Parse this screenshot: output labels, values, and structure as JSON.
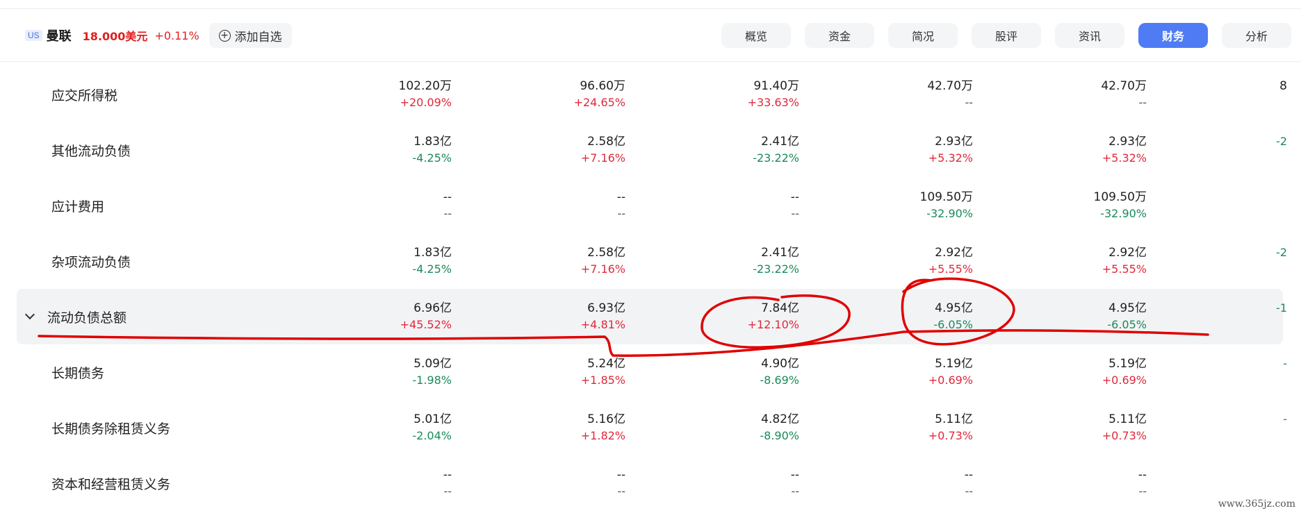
{
  "header": {
    "market_badge": "US",
    "name": "曼联",
    "price": "18.000美元",
    "change_pct": "+0.11%",
    "watch_label": "添加自选",
    "watch_icon": "plus-circle-icon"
  },
  "tabs": [
    {
      "label": "概览",
      "active": false
    },
    {
      "label": "资金",
      "active": false
    },
    {
      "label": "简况",
      "active": false
    },
    {
      "label": "股评",
      "active": false
    },
    {
      "label": "资讯",
      "active": false
    },
    {
      "label": "财务",
      "active": true
    },
    {
      "label": "分析",
      "active": false
    }
  ],
  "colors": {
    "accent": "#4f7cf5",
    "up": "#e0283a",
    "down": "#1a8a5a",
    "annotation": "#e00000"
  },
  "rows": [
    {
      "label": "应交所得税",
      "highlight": false,
      "cells": [
        {
          "v": "102.20万",
          "c": "+20.09%",
          "t": "up"
        },
        {
          "v": "96.60万",
          "c": "+24.65%",
          "t": "up"
        },
        {
          "v": "91.40万",
          "c": "+33.63%",
          "t": "up"
        },
        {
          "v": "42.70万",
          "c": "--",
          "t": "flat"
        },
        {
          "v": "42.70万",
          "c": "--",
          "t": "flat"
        },
        {
          "v": "8",
          "c": "",
          "t": "flat"
        }
      ]
    },
    {
      "label": "其他流动负债",
      "highlight": false,
      "cells": [
        {
          "v": "1.83亿",
          "c": "-4.25%",
          "t": "down"
        },
        {
          "v": "2.58亿",
          "c": "+7.16%",
          "t": "up"
        },
        {
          "v": "2.41亿",
          "c": "-23.22%",
          "t": "down"
        },
        {
          "v": "2.93亿",
          "c": "+5.32%",
          "t": "up"
        },
        {
          "v": "2.93亿",
          "c": "+5.32%",
          "t": "up"
        },
        {
          "v": "",
          "c": "-2",
          "t": "down"
        }
      ]
    },
    {
      "label": "应计费用",
      "highlight": false,
      "cells": [
        {
          "v": "--",
          "c": "--",
          "t": "flat"
        },
        {
          "v": "--",
          "c": "--",
          "t": "flat"
        },
        {
          "v": "--",
          "c": "--",
          "t": "flat"
        },
        {
          "v": "109.50万",
          "c": "-32.90%",
          "t": "down"
        },
        {
          "v": "109.50万",
          "c": "-32.90%",
          "t": "down"
        },
        {
          "v": "",
          "c": "",
          "t": "flat"
        }
      ]
    },
    {
      "label": "杂项流动负债",
      "highlight": false,
      "cells": [
        {
          "v": "1.83亿",
          "c": "-4.25%",
          "t": "down"
        },
        {
          "v": "2.58亿",
          "c": "+7.16%",
          "t": "up"
        },
        {
          "v": "2.41亿",
          "c": "-23.22%",
          "t": "down"
        },
        {
          "v": "2.92亿",
          "c": "+5.55%",
          "t": "up"
        },
        {
          "v": "2.92亿",
          "c": "+5.55%",
          "t": "up"
        },
        {
          "v": "",
          "c": "-2",
          "t": "down"
        }
      ]
    },
    {
      "label": "流动负债总额",
      "highlight": true,
      "cells": [
        {
          "v": "6.96亿",
          "c": "+45.52%",
          "t": "up"
        },
        {
          "v": "6.93亿",
          "c": "+4.81%",
          "t": "up"
        },
        {
          "v": "7.84亿",
          "c": "+12.10%",
          "t": "up"
        },
        {
          "v": "4.95亿",
          "c": "-6.05%",
          "t": "down"
        },
        {
          "v": "4.95亿",
          "c": "-6.05%",
          "t": "down"
        },
        {
          "v": "",
          "c": "-1",
          "t": "down"
        }
      ]
    },
    {
      "label": "长期债务",
      "highlight": false,
      "cells": [
        {
          "v": "5.09亿",
          "c": "-1.98%",
          "t": "down"
        },
        {
          "v": "5.24亿",
          "c": "+1.85%",
          "t": "up"
        },
        {
          "v": "4.90亿",
          "c": "-8.69%",
          "t": "down"
        },
        {
          "v": "5.19亿",
          "c": "+0.69%",
          "t": "up"
        },
        {
          "v": "5.19亿",
          "c": "+0.69%",
          "t": "up"
        },
        {
          "v": "",
          "c": "-",
          "t": "down"
        }
      ]
    },
    {
      "label": "长期债务除租赁义务",
      "highlight": false,
      "cells": [
        {
          "v": "5.01亿",
          "c": "-2.04%",
          "t": "down"
        },
        {
          "v": "5.16亿",
          "c": "+1.82%",
          "t": "up"
        },
        {
          "v": "4.82亿",
          "c": "-8.90%",
          "t": "down"
        },
        {
          "v": "5.11亿",
          "c": "+0.73%",
          "t": "up"
        },
        {
          "v": "5.11亿",
          "c": "+0.73%",
          "t": "up"
        },
        {
          "v": "",
          "c": "-",
          "t": "down"
        }
      ]
    },
    {
      "label": "资本和经营租赁义务",
      "highlight": false,
      "cells": [
        {
          "v": "--",
          "c": "--",
          "t": "flat"
        },
        {
          "v": "--",
          "c": "--",
          "t": "flat"
        },
        {
          "v": "--",
          "c": "--",
          "t": "flat"
        },
        {
          "v": "--",
          "c": "--",
          "t": "flat"
        },
        {
          "v": "--",
          "c": "--",
          "t": "flat"
        },
        {
          "v": "",
          "c": "",
          "t": "flat"
        }
      ]
    }
  ],
  "watermark": "www.365jz.com"
}
